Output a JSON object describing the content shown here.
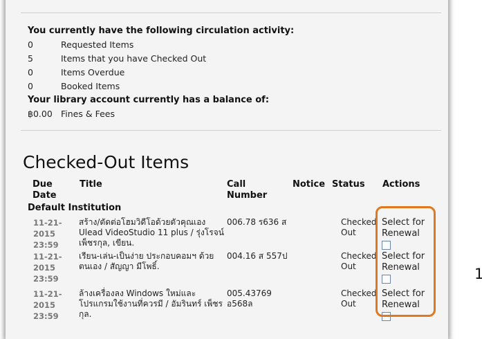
{
  "circulation": {
    "heading": "You currently have the following circulation activity:",
    "rows": [
      {
        "count": "0",
        "label": "Requested Items"
      },
      {
        "count": "5",
        "label": "Items that you have Checked Out"
      },
      {
        "count": "0",
        "label": "Items Overdue"
      },
      {
        "count": "0",
        "label": "Booked Items"
      }
    ],
    "balance_heading": "Your library account currently has a balance of:",
    "balance": {
      "amount": "฿0.00",
      "label": "Fines & Fees"
    }
  },
  "checked_out": {
    "title": "Checked-Out Items",
    "columns": {
      "due_date": "Due Date",
      "title": "Title",
      "call_number": "Call Number",
      "notice": "Notice",
      "status": "Status",
      "actions": "Actions"
    },
    "institution": "Default Institution",
    "items": [
      {
        "due_date": "11-21-2015 23:59",
        "title": "สร้าง/ตัดต่อโฮมวิดีโอด้วยตัวคุณเอง Ulead VideoStudio 11 plus / รุ่งโรจน์ เพ็ชรกุล, เขียน.",
        "call_number": "006.78 ร636 ส",
        "status": "Checked Out",
        "action": "Select for Renewal"
      },
      {
        "due_date": "11-21-2015 23:59",
        "title": "เรียน-เล่น-เป็นง่าย ประกอบคอมฯ ด้วยตนเอง / สัญญา มีโพธิ์.",
        "call_number": "004.16 ส 557ป",
        "status": "Checked Out",
        "action": "Select for Renewal"
      },
      {
        "due_date": "11-21-2015 23:59",
        "title": "ล้างเครื่องลง Windows ใหม่และโปรแกรมใช้งานที่ควรมี / อัมรินทร์ เพ็ชรกุล.",
        "call_number": "005.43769 อ568ล",
        "status": "Checked Out",
        "action": "Select for Renewal"
      }
    ]
  },
  "page_number": "1",
  "colors": {
    "highlight": "#e0781e",
    "panel_bg": "#f4f4f4",
    "due_date_text": "#777777"
  }
}
